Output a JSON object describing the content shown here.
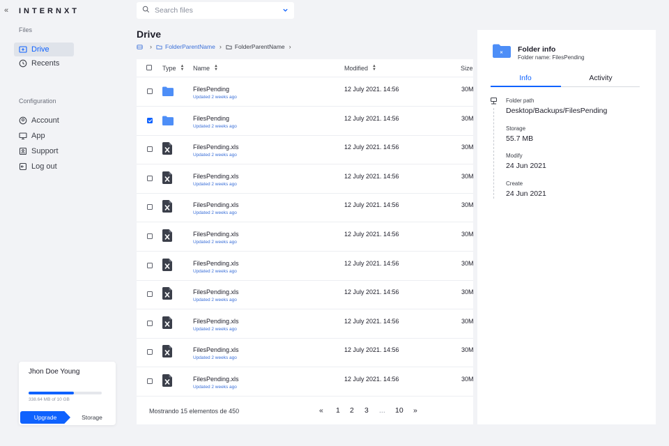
{
  "brand": "INTERNXT",
  "sidebar": {
    "collapse_glyph": "«",
    "files_title": "Files",
    "files_items": [
      {
        "label": "Drive",
        "icon": "drive-icon",
        "active": true
      },
      {
        "label": "Recents",
        "icon": "clock-icon",
        "active": false
      }
    ],
    "config_title": "Configuration",
    "config_items": [
      {
        "label": "Account",
        "icon": "user-icon"
      },
      {
        "label": "App",
        "icon": "monitor-icon"
      },
      {
        "label": "Support",
        "icon": "support-icon"
      },
      {
        "label": "Log out",
        "icon": "logout-icon"
      }
    ]
  },
  "storage": {
    "user": "Jhon Doe Young",
    "used_text": "338.64 MB of 10 GB",
    "used_fraction": 0.62,
    "upgrade_label": "Upgrade",
    "storage_label": "Storage"
  },
  "search": {
    "placeholder": "Search files",
    "value": ""
  },
  "page": {
    "title": "Drive",
    "breadcrumb": [
      "FolderParentName",
      "FolderParentName"
    ]
  },
  "table": {
    "headers": {
      "type": "Type",
      "name": "Name",
      "modified": "Modified",
      "size": "Size"
    },
    "rows": [
      {
        "kind": "folder",
        "name": "FilesPending",
        "sub": "Updated 2 weeks ago",
        "modified": "12 July 2021. 14:56",
        "size": "30M",
        "checked": false
      },
      {
        "kind": "folder",
        "name": "FilesPending",
        "sub": "Updated 2 weeks ago",
        "modified": "12 July 2021. 14:56",
        "size": "30M",
        "checked": true
      },
      {
        "kind": "xls",
        "name": "FilesPending.xls",
        "sub": "Updated 2 weeks ago",
        "modified": "12 July 2021. 14:56",
        "size": "30M",
        "checked": false
      },
      {
        "kind": "xls",
        "name": "FilesPending.xls",
        "sub": "Updated 2 weeks ago",
        "modified": "12 July 2021. 14:56",
        "size": "30M",
        "checked": false
      },
      {
        "kind": "xls",
        "name": "FilesPending.xls",
        "sub": "Updated 2 weeks ago",
        "modified": "12 July 2021. 14:56",
        "size": "30M",
        "checked": false
      },
      {
        "kind": "xls",
        "name": "FilesPending.xls",
        "sub": "Updated 2 weeks ago",
        "modified": "12 July 2021. 14:56",
        "size": "30M",
        "checked": false
      },
      {
        "kind": "xls",
        "name": "FilesPending.xls",
        "sub": "Updated 2 weeks ago",
        "modified": "12 July 2021. 14:56",
        "size": "30M",
        "checked": false
      },
      {
        "kind": "xls",
        "name": "FilesPending.xls",
        "sub": "Updated 2 weeks ago",
        "modified": "12 July 2021. 14:56",
        "size": "30M",
        "checked": false
      },
      {
        "kind": "xls",
        "name": "FilesPending.xls",
        "sub": "Updated 2 weeks ago",
        "modified": "12 July 2021. 14:56",
        "size": "30M",
        "checked": false
      },
      {
        "kind": "xls",
        "name": "FilesPending.xls",
        "sub": "Updated 2 weeks ago",
        "modified": "12 July 2021. 14:56",
        "size": "30M",
        "checked": false
      },
      {
        "kind": "xls",
        "name": "FilesPending.xls",
        "sub": "Updated 2 weeks ago",
        "modified": "12 July 2021. 14:56",
        "size": "30M",
        "checked": false
      }
    ],
    "footer": "Mostrando 15 elementos de 450",
    "pagination": {
      "first": "«",
      "pages": [
        "1",
        "2",
        "3"
      ],
      "ellipsis": "...",
      "last_page": "10",
      "last": "»"
    }
  },
  "info_panel": {
    "title": "Folder info",
    "subtitle": "Folder name: FilesPending",
    "tabs": [
      "Info",
      "Activity"
    ],
    "fields": [
      {
        "label": "Folder path",
        "value": "Desktop/Backups/FilesPending"
      },
      {
        "label": "Storage",
        "value": "55.7 MB"
      },
      {
        "label": "Modify",
        "value": "24 Jun 2021"
      },
      {
        "label": "Create",
        "value": "24 Jun 2021"
      }
    ]
  },
  "colors": {
    "accent": "#0f62fe",
    "folder": "#4d8ef7",
    "xls_icon": "#3b3f4a"
  }
}
